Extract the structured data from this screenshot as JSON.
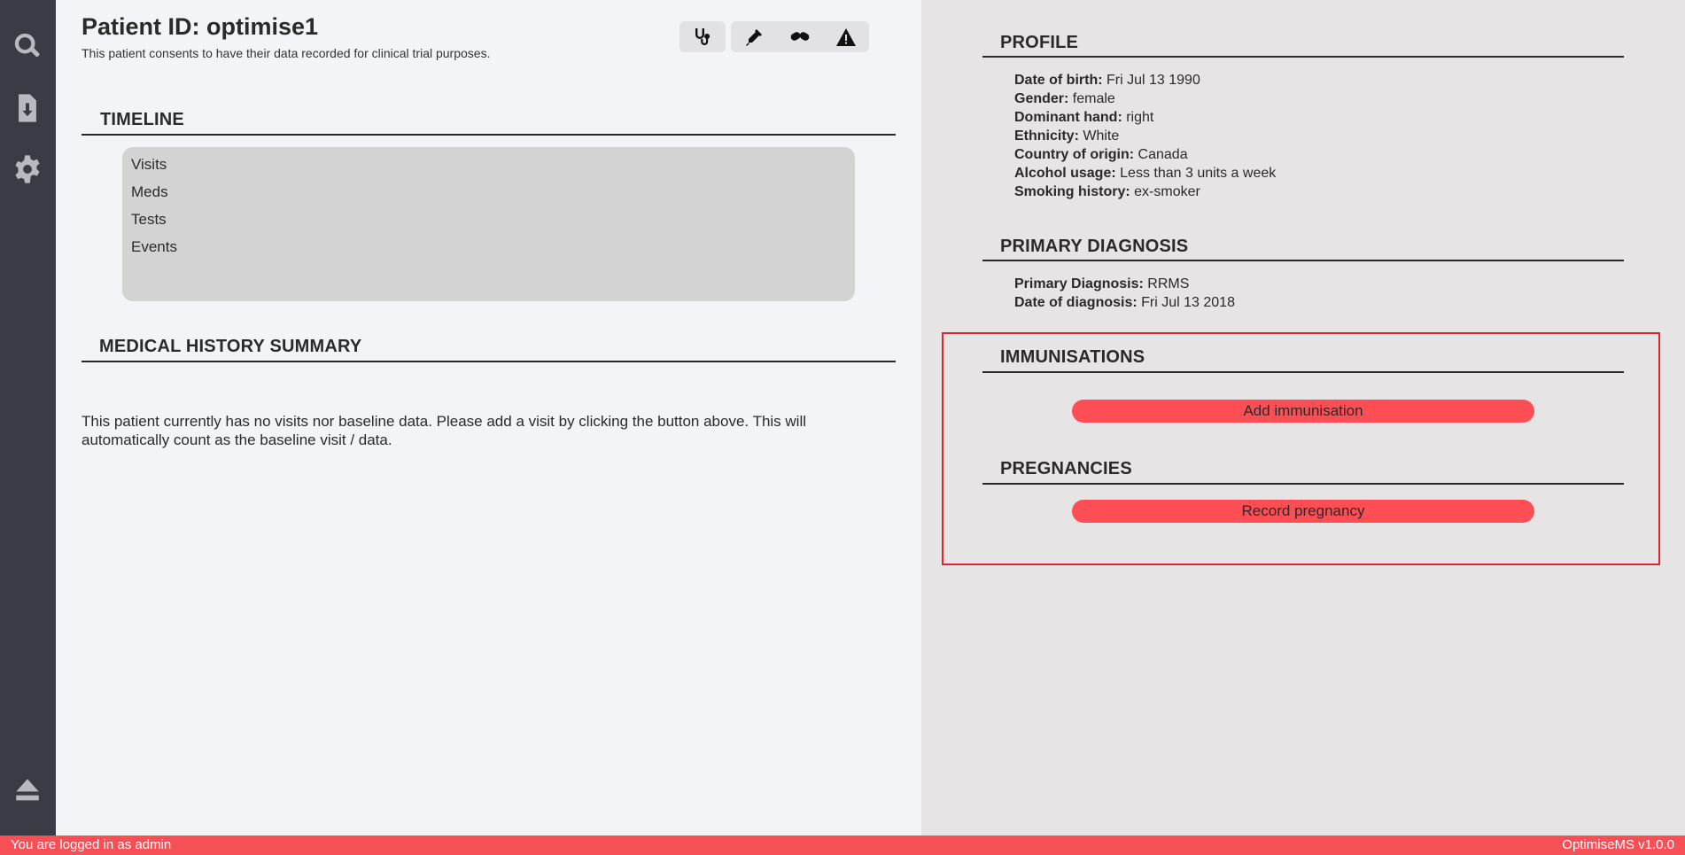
{
  "sidebar": {
    "icons": [
      "search-icon",
      "download-file-icon",
      "gear-icon",
      "eject-icon"
    ]
  },
  "header": {
    "title_label": "Patient ID: ",
    "patient_id": "optimise1",
    "consent": "This patient consents to have their data recorded for clinical trial purposes."
  },
  "toolbar": {
    "buttons": [
      "stethoscope-icon",
      "syringe-icon",
      "pills-icon",
      "warning-icon"
    ]
  },
  "timeline": {
    "heading": "TIMELINE",
    "rows": [
      "Visits",
      "Meds",
      "Tests",
      "Events"
    ]
  },
  "history": {
    "heading": "MEDICAL HISTORY SUMMARY",
    "message": "This patient currently has no visits nor baseline data. Please add a visit by clicking the button above. This will automatically count as the baseline visit / data."
  },
  "profile": {
    "heading": "PROFILE",
    "fields": [
      {
        "label": "Date of birth:",
        "value": "Fri Jul 13 1990"
      },
      {
        "label": "Gender:",
        "value": "female"
      },
      {
        "label": "Dominant hand:",
        "value": "right"
      },
      {
        "label": "Ethnicity:",
        "value": "White"
      },
      {
        "label": "Country of origin:",
        "value": "Canada"
      },
      {
        "label": "Alcohol usage:",
        "value": "Less than 3 units a week"
      },
      {
        "label": "Smoking history:",
        "value": "ex-smoker"
      }
    ]
  },
  "diagnosis": {
    "heading": "PRIMARY DIAGNOSIS",
    "fields": [
      {
        "label": "Primary Diagnosis:",
        "value": "RRMS"
      },
      {
        "label": "Date of diagnosis:",
        "value": "Fri Jul 13 2018"
      }
    ]
  },
  "immunisations": {
    "heading": "IMMUNISATIONS",
    "button": "Add immunisation"
  },
  "pregnancies": {
    "heading": "PREGNANCIES",
    "button": "Record pregnancy"
  },
  "status": {
    "left": "You are logged in as admin",
    "right": "OptimiseMS v1.0.0"
  },
  "colors": {
    "sidebar": "#3a3b45",
    "accent": "#f64f56",
    "highlight": "#e0242c"
  }
}
